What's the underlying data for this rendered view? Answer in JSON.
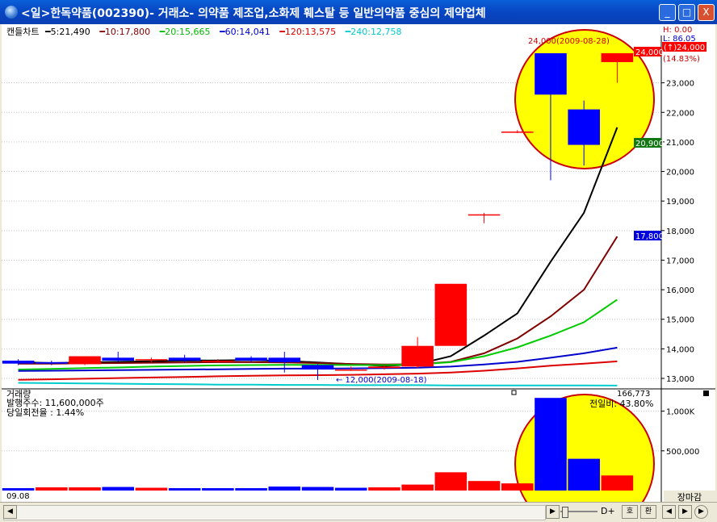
{
  "window": {
    "title": "<일>한독약품(002390)- 거래소- 의약품 제조업,소화제 훼스탈 등 일반의약품 중심의 제약업체",
    "btn_min": "_",
    "btn_max": "□",
    "btn_close": "X"
  },
  "legend": {
    "chart_type": "캔들차트",
    "ma5": "5:21,490",
    "ma10": "10:17,800",
    "ma20": "20:15,665",
    "ma60": "60:14,041",
    "ma120": "120:13,575",
    "ma240": "240:12,758"
  },
  "price_panel": {
    "high_label": "H: 0.00",
    "low_label": "L: 86.05",
    "last_badge": "(↑)24,000",
    "change_pct": "(14.83%)",
    "tag_last": "24,000",
    "tag_ma5": "20,900",
    "tag_ma10": "17,800",
    "high_annotation": "24,000(2009-08-28)",
    "low_annotation": "← 12,000(2009-08-18)",
    "axis_ticks": [
      "23,000",
      "22,000",
      "21,000",
      "20,000",
      "19,000",
      "18,000",
      "17,000",
      "16,000",
      "15,000",
      "14,000",
      "13,000"
    ]
  },
  "volume_panel": {
    "title": "거래량",
    "shares_outstanding": "발행주수:  11,600,000주",
    "turnover": "당일회전율 : 1.44%",
    "top_value": "166,773",
    "prev_day_ratio": "전일비: 43.80%",
    "axis_ticks": [
      "1,000K",
      "500,000"
    ]
  },
  "bottom": {
    "date_label": "09.08",
    "market_close": "장마감",
    "d_label": "D+",
    "btn_ho": "호",
    "btn_ring": "환"
  },
  "colors": {
    "up": "#ff0000",
    "down": "#0000ff",
    "ma5": "#000000",
    "ma10": "#800000",
    "ma20": "#00cc00",
    "ma60": "#0000cc",
    "ma120": "#dd0000",
    "ma240": "#00cccc",
    "highlight_fill": "#ffff00",
    "highlight_stroke": "#cc0000"
  },
  "chart_data": [
    {
      "type": "candlestick",
      "title": "캔들차트",
      "ylim": [
        12700,
        24600
      ],
      "candles": [
        {
          "o": 13600,
          "h": 13650,
          "l": 13450,
          "c": 13500
        },
        {
          "o": 13550,
          "h": 13600,
          "l": 13450,
          "c": 13500
        },
        {
          "o": 13480,
          "h": 13750,
          "l": 13450,
          "c": 13750
        },
        {
          "o": 13700,
          "h": 13900,
          "l": 13550,
          "c": 13600
        },
        {
          "o": 13650,
          "h": 13700,
          "l": 13550,
          "c": 13650
        },
        {
          "o": 13700,
          "h": 13800,
          "l": 13550,
          "c": 13600
        },
        {
          "o": 13600,
          "h": 13650,
          "l": 13550,
          "c": 13600
        },
        {
          "o": 13700,
          "h": 13750,
          "l": 13550,
          "c": 13600
        },
        {
          "o": 13700,
          "h": 13900,
          "l": 13200,
          "c": 13550
        },
        {
          "o": 13450,
          "h": 13500,
          "l": 12950,
          "c": 13300
        },
        {
          "o": 13300,
          "h": 13400,
          "l": 13250,
          "c": 13300
        },
        {
          "o": 13350,
          "h": 13450,
          "l": 13300,
          "c": 13400
        },
        {
          "o": 13400,
          "h": 14400,
          "l": 13350,
          "c": 14100
        },
        {
          "o": 14100,
          "h": 16200,
          "l": 14100,
          "c": 16200
        },
        {
          "o": 18550,
          "h": 18600,
          "l": 18250,
          "c": 18550
        },
        {
          "o": 21350,
          "h": 21400,
          "l": 21300,
          "c": 21350
        },
        {
          "o": 24000,
          "h": 24000,
          "l": 19700,
          "c": 22600
        },
        {
          "o": 22100,
          "h": 22400,
          "l": 20200,
          "c": 20900
        },
        {
          "o": 23700,
          "h": 24000,
          "l": 23000,
          "c": 24000
        }
      ],
      "moving_averages": {
        "ma5": [
          13550,
          13520,
          13540,
          13560,
          13580,
          13600,
          13610,
          13620,
          13590,
          13540,
          13480,
          13420,
          13480,
          13750,
          14450,
          15200,
          16950,
          18600,
          21490
        ],
        "ma10": [
          13500,
          13500,
          13510,
          13520,
          13530,
          13540,
          13550,
          13550,
          13540,
          13520,
          13490,
          13470,
          13480,
          13560,
          13850,
          14350,
          15100,
          16000,
          17800
        ],
        "ma20": [
          13300,
          13320,
          13350,
          13370,
          13400,
          13420,
          13440,
          13450,
          13460,
          13460,
          13450,
          13450,
          13470,
          13550,
          13750,
          14050,
          14450,
          14900,
          15665
        ],
        "ma60": [
          13250,
          13260,
          13270,
          13280,
          13290,
          13300,
          13310,
          13320,
          13330,
          13330,
          13340,
          13350,
          13360,
          13400,
          13470,
          13560,
          13700,
          13850,
          14041
        ],
        "ma120": [
          12950,
          12970,
          12990,
          13010,
          13030,
          13050,
          13070,
          13090,
          13100,
          13110,
          13120,
          13140,
          13160,
          13200,
          13260,
          13340,
          13430,
          13500,
          13575
        ],
        "ma240": [
          12850,
          12840,
          12830,
          12820,
          12810,
          12800,
          12790,
          12790,
          12780,
          12780,
          12770,
          12770,
          12770,
          12760,
          12760,
          12760,
          12760,
          12760,
          12758
        ]
      }
    },
    {
      "type": "bar",
      "title": "거래량",
      "ylim": [
        0,
        1250000
      ],
      "values": [
        30000,
        40000,
        40000,
        45000,
        35000,
        30000,
        30000,
        30000,
        50000,
        45000,
        35000,
        40000,
        75000,
        230000,
        120000,
        90000,
        1166773,
        400000,
        190000
      ],
      "directions": [
        "down",
        "up",
        "up",
        "down",
        "up",
        "down",
        "down",
        "down",
        "down",
        "down",
        "down",
        "up",
        "up",
        "up",
        "up",
        "up",
        "down",
        "down",
        "up"
      ]
    }
  ]
}
